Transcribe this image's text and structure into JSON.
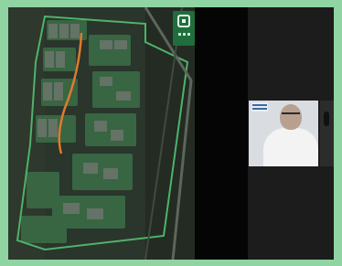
{
  "app": {
    "background_color": "#8fd4a2"
  },
  "shared_screen": {
    "map_label": "",
    "logo_icon": "organization-logo-icon"
  },
  "participant": {
    "tile_icon": "participant-video-icon"
  }
}
